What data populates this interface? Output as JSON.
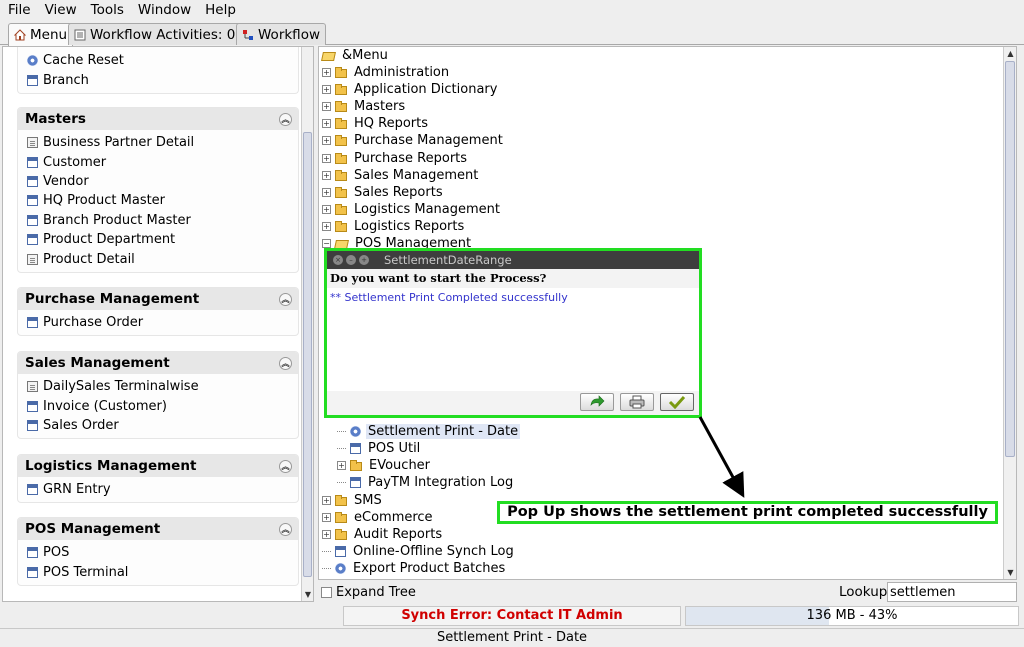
{
  "menubar": {
    "items": [
      "File",
      "View",
      "Tools",
      "Window",
      "Help"
    ]
  },
  "tabs": [
    {
      "label": "Menu",
      "icon": "home-icon"
    },
    {
      "label": "Workflow Activities: 0",
      "icon": "activities-icon"
    },
    {
      "label": "Workflow",
      "icon": "workflow-icon"
    }
  ],
  "left": {
    "top_items": [
      {
        "label": "Cache Reset",
        "icon": "gear-icon"
      },
      {
        "label": "Branch",
        "icon": "window-icon"
      }
    ],
    "sections": [
      {
        "title": "Masters",
        "items": [
          {
            "label": "Business Partner Detail",
            "icon": "document-icon"
          },
          {
            "label": "Customer",
            "icon": "window-icon"
          },
          {
            "label": "Vendor",
            "icon": "window-icon"
          },
          {
            "label": "HQ Product Master",
            "icon": "window-icon"
          },
          {
            "label": "Branch Product Master",
            "icon": "window-icon"
          },
          {
            "label": "Product Department",
            "icon": "window-icon"
          },
          {
            "label": "Product Detail",
            "icon": "document-icon"
          }
        ]
      },
      {
        "title": "Purchase Management",
        "items": [
          {
            "label": "Purchase Order",
            "icon": "window-icon"
          }
        ]
      },
      {
        "title": "Sales Management",
        "items": [
          {
            "label": "DailySales Terminalwise",
            "icon": "document-icon"
          },
          {
            "label": "Invoice (Customer)",
            "icon": "window-icon"
          },
          {
            "label": "Sales Order",
            "icon": "window-icon"
          }
        ]
      },
      {
        "title": "Logistics Management",
        "items": [
          {
            "label": "GRN Entry",
            "icon": "window-icon"
          }
        ]
      },
      {
        "title": "POS Management",
        "items": [
          {
            "label": "POS",
            "icon": "window-icon"
          },
          {
            "label": "POS Terminal",
            "icon": "window-icon"
          }
        ]
      }
    ]
  },
  "tree": {
    "root": "&Menu",
    "top": [
      "Administration",
      "Application Dictionary",
      "Masters",
      "HQ Reports",
      "Purchase Management",
      "Purchase Reports",
      "Sales Management",
      "Sales Reports",
      "Logistics Management",
      "Logistics Reports",
      "POS Management"
    ],
    "pos_children": [
      {
        "label": "Settlement Print - Date",
        "icon": "gear-icon",
        "expandable": false,
        "selected": true
      },
      {
        "label": "POS Util",
        "icon": "window-icon",
        "expandable": false
      },
      {
        "label": "EVoucher",
        "icon": "folder-icon",
        "expandable": true
      },
      {
        "label": "PayTM Integration Log",
        "icon": "window-icon",
        "expandable": false
      }
    ],
    "bottom": [
      {
        "label": "SMS",
        "icon": "folder-icon",
        "expandable": true
      },
      {
        "label": "eCommerce",
        "icon": "folder-icon",
        "expandable": true
      },
      {
        "label": "Audit Reports",
        "icon": "folder-icon",
        "expandable": true
      },
      {
        "label": "Online-Offline Synch Log",
        "icon": "window-icon",
        "expandable": false
      },
      {
        "label": "Export Product Batches",
        "icon": "gear-icon",
        "expandable": false
      }
    ]
  },
  "bottombar": {
    "expand_label": "Expand Tree",
    "lookup_label": "Lookup",
    "lookup_value": "settlemen"
  },
  "status": {
    "synch_error": "Synch Error: Contact IT Admin",
    "memory": "136 MB - 43%",
    "memory_percent": 43,
    "bottom": "Settlement Print - Date"
  },
  "dialog": {
    "title": "SettlementDateRange",
    "question": "Do you want to start the Process?",
    "message": "** Settlement Print Completed successfully"
  },
  "annotation": {
    "text": "Pop Up shows the settlement print completed successfully"
  },
  "colors": {
    "highlight": "#22dd22",
    "error": "#d00000",
    "message": "#3333cc"
  }
}
